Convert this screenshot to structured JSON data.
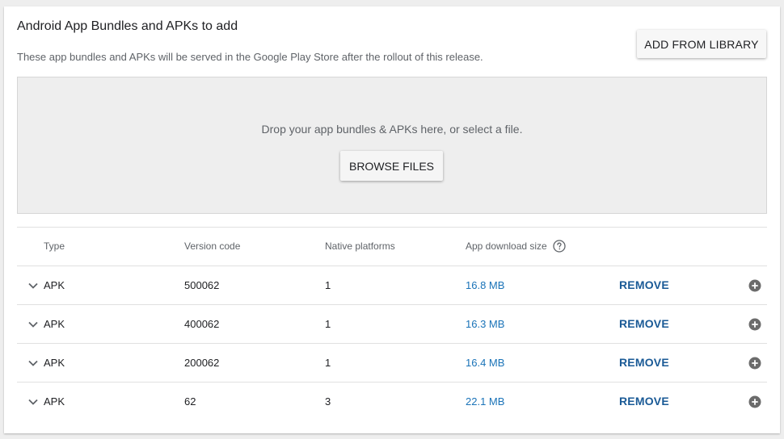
{
  "section": {
    "title": "Android App Bundles and APKs to add",
    "subtitle": "These app bundles and APKs will be served in the Google Play Store after the rollout of this release.",
    "add_from_library_label": "ADD FROM LIBRARY"
  },
  "dropzone": {
    "text": "Drop your app bundles & APKs here, or select a file.",
    "browse_label": "BROWSE FILES"
  },
  "table": {
    "headers": {
      "type": "Type",
      "version_code": "Version code",
      "native_platforms": "Native platforms",
      "app_download_size": "App download size"
    },
    "rows": [
      {
        "type": "APK",
        "version_code": "500062",
        "native_platforms": "1",
        "size": "16.8 MB",
        "action": "REMOVE"
      },
      {
        "type": "APK",
        "version_code": "400062",
        "native_platforms": "1",
        "size": "16.3 MB",
        "action": "REMOVE"
      },
      {
        "type": "APK",
        "version_code": "200062",
        "native_platforms": "1",
        "size": "16.4 MB",
        "action": "REMOVE"
      },
      {
        "type": "APK",
        "version_code": "62",
        "native_platforms": "3",
        "size": "22.1 MB",
        "action": "REMOVE"
      }
    ]
  },
  "icons": {
    "expand": "chevron-down-icon",
    "help": "help-circle-icon",
    "add": "plus-circle-icon"
  },
  "colors": {
    "link": "#1a73b8",
    "action": "#1a5a96"
  }
}
